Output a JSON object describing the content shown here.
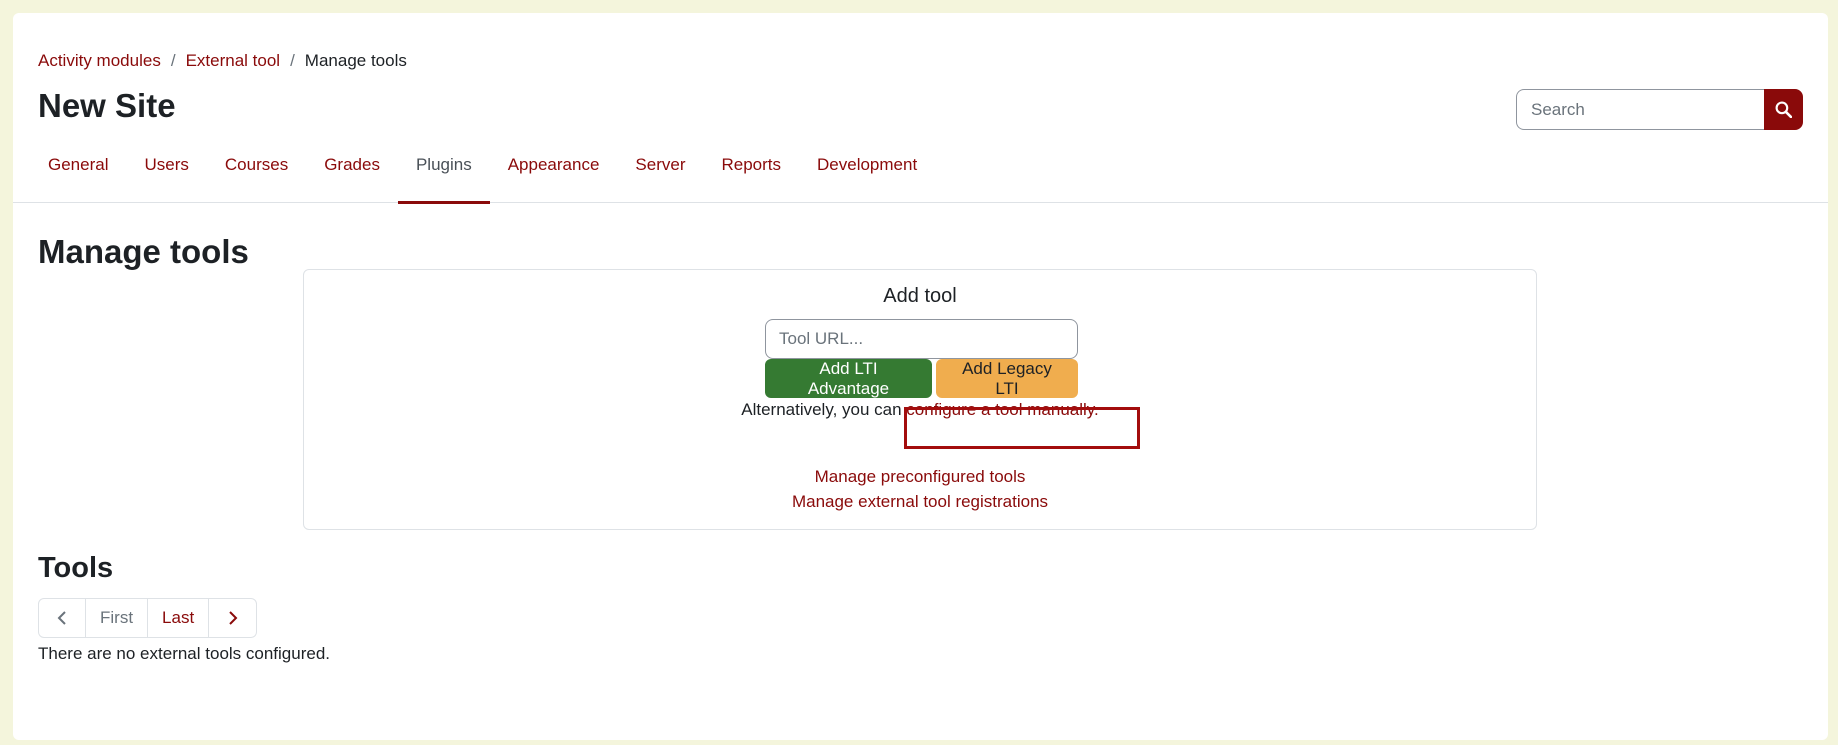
{
  "breadcrumb": {
    "items": [
      "Activity modules",
      "External tool"
    ],
    "current": "Manage tools",
    "separator": "/"
  },
  "header": {
    "site_title": "New Site",
    "search_placeholder": "Search"
  },
  "nav": {
    "tabs": [
      {
        "label": "General"
      },
      {
        "label": "Users"
      },
      {
        "label": "Courses"
      },
      {
        "label": "Grades"
      },
      {
        "label": "Plugins",
        "active": true
      },
      {
        "label": "Appearance"
      },
      {
        "label": "Server"
      },
      {
        "label": "Reports"
      },
      {
        "label": "Development"
      }
    ]
  },
  "main": {
    "title": "Manage tools",
    "add_tool": {
      "title": "Add tool",
      "url_placeholder": "Tool URL...",
      "btn_lti_advantage": "Add LTI Advantage",
      "btn_legacy_lti": "Add Legacy LTI",
      "alt_prefix": "Alternatively, you can ",
      "alt_link": "configure a tool manually.",
      "link_preconfigured": "Manage preconfigured tools",
      "link_registrations": "Manage external tool registrations"
    },
    "tools": {
      "title": "Tools",
      "pager_first": "First",
      "pager_last": "Last",
      "empty_message": "There are no external tools configured."
    }
  },
  "colors": {
    "brand": "#8a0a0a",
    "success": "#357a32",
    "warning": "#f0ad4e",
    "outer_bg": "#f4f5dc"
  },
  "icons": {
    "search": "search-icon",
    "prev": "chevron-left-icon",
    "next": "chevron-right-icon"
  }
}
